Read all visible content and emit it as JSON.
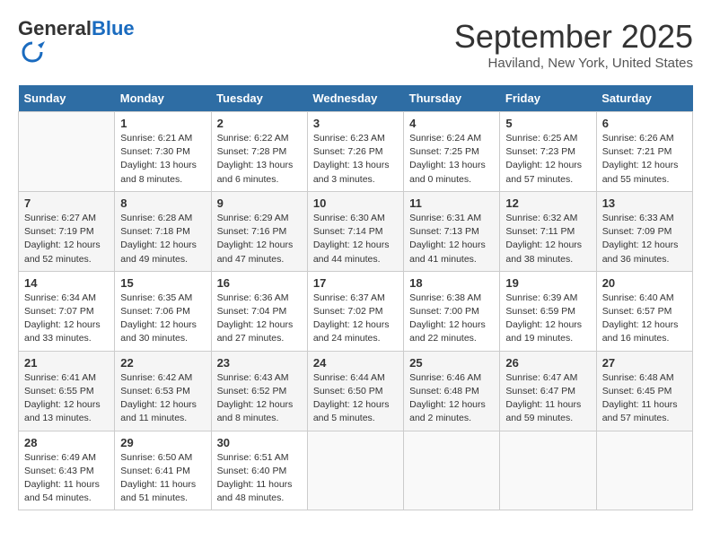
{
  "logo": {
    "general": "General",
    "blue": "Blue"
  },
  "title": "September 2025",
  "location": "Haviland, New York, United States",
  "days_of_week": [
    "Sunday",
    "Monday",
    "Tuesday",
    "Wednesday",
    "Thursday",
    "Friday",
    "Saturday"
  ],
  "weeks": [
    [
      {
        "day": "",
        "info": ""
      },
      {
        "day": "1",
        "info": "Sunrise: 6:21 AM\nSunset: 7:30 PM\nDaylight: 13 hours\nand 8 minutes."
      },
      {
        "day": "2",
        "info": "Sunrise: 6:22 AM\nSunset: 7:28 PM\nDaylight: 13 hours\nand 6 minutes."
      },
      {
        "day": "3",
        "info": "Sunrise: 6:23 AM\nSunset: 7:26 PM\nDaylight: 13 hours\nand 3 minutes."
      },
      {
        "day": "4",
        "info": "Sunrise: 6:24 AM\nSunset: 7:25 PM\nDaylight: 13 hours\nand 0 minutes."
      },
      {
        "day": "5",
        "info": "Sunrise: 6:25 AM\nSunset: 7:23 PM\nDaylight: 12 hours\nand 57 minutes."
      },
      {
        "day": "6",
        "info": "Sunrise: 6:26 AM\nSunset: 7:21 PM\nDaylight: 12 hours\nand 55 minutes."
      }
    ],
    [
      {
        "day": "7",
        "info": "Sunrise: 6:27 AM\nSunset: 7:19 PM\nDaylight: 12 hours\nand 52 minutes."
      },
      {
        "day": "8",
        "info": "Sunrise: 6:28 AM\nSunset: 7:18 PM\nDaylight: 12 hours\nand 49 minutes."
      },
      {
        "day": "9",
        "info": "Sunrise: 6:29 AM\nSunset: 7:16 PM\nDaylight: 12 hours\nand 47 minutes."
      },
      {
        "day": "10",
        "info": "Sunrise: 6:30 AM\nSunset: 7:14 PM\nDaylight: 12 hours\nand 44 minutes."
      },
      {
        "day": "11",
        "info": "Sunrise: 6:31 AM\nSunset: 7:13 PM\nDaylight: 12 hours\nand 41 minutes."
      },
      {
        "day": "12",
        "info": "Sunrise: 6:32 AM\nSunset: 7:11 PM\nDaylight: 12 hours\nand 38 minutes."
      },
      {
        "day": "13",
        "info": "Sunrise: 6:33 AM\nSunset: 7:09 PM\nDaylight: 12 hours\nand 36 minutes."
      }
    ],
    [
      {
        "day": "14",
        "info": "Sunrise: 6:34 AM\nSunset: 7:07 PM\nDaylight: 12 hours\nand 33 minutes."
      },
      {
        "day": "15",
        "info": "Sunrise: 6:35 AM\nSunset: 7:06 PM\nDaylight: 12 hours\nand 30 minutes."
      },
      {
        "day": "16",
        "info": "Sunrise: 6:36 AM\nSunset: 7:04 PM\nDaylight: 12 hours\nand 27 minutes."
      },
      {
        "day": "17",
        "info": "Sunrise: 6:37 AM\nSunset: 7:02 PM\nDaylight: 12 hours\nand 24 minutes."
      },
      {
        "day": "18",
        "info": "Sunrise: 6:38 AM\nSunset: 7:00 PM\nDaylight: 12 hours\nand 22 minutes."
      },
      {
        "day": "19",
        "info": "Sunrise: 6:39 AM\nSunset: 6:59 PM\nDaylight: 12 hours\nand 19 minutes."
      },
      {
        "day": "20",
        "info": "Sunrise: 6:40 AM\nSunset: 6:57 PM\nDaylight: 12 hours\nand 16 minutes."
      }
    ],
    [
      {
        "day": "21",
        "info": "Sunrise: 6:41 AM\nSunset: 6:55 PM\nDaylight: 12 hours\nand 13 minutes."
      },
      {
        "day": "22",
        "info": "Sunrise: 6:42 AM\nSunset: 6:53 PM\nDaylight: 12 hours\nand 11 minutes."
      },
      {
        "day": "23",
        "info": "Sunrise: 6:43 AM\nSunset: 6:52 PM\nDaylight: 12 hours\nand 8 minutes."
      },
      {
        "day": "24",
        "info": "Sunrise: 6:44 AM\nSunset: 6:50 PM\nDaylight: 12 hours\nand 5 minutes."
      },
      {
        "day": "25",
        "info": "Sunrise: 6:46 AM\nSunset: 6:48 PM\nDaylight: 12 hours\nand 2 minutes."
      },
      {
        "day": "26",
        "info": "Sunrise: 6:47 AM\nSunset: 6:47 PM\nDaylight: 11 hours\nand 59 minutes."
      },
      {
        "day": "27",
        "info": "Sunrise: 6:48 AM\nSunset: 6:45 PM\nDaylight: 11 hours\nand 57 minutes."
      }
    ],
    [
      {
        "day": "28",
        "info": "Sunrise: 6:49 AM\nSunset: 6:43 PM\nDaylight: 11 hours\nand 54 minutes."
      },
      {
        "day": "29",
        "info": "Sunrise: 6:50 AM\nSunset: 6:41 PM\nDaylight: 11 hours\nand 51 minutes."
      },
      {
        "day": "30",
        "info": "Sunrise: 6:51 AM\nSunset: 6:40 PM\nDaylight: 11 hours\nand 48 minutes."
      },
      {
        "day": "",
        "info": ""
      },
      {
        "day": "",
        "info": ""
      },
      {
        "day": "",
        "info": ""
      },
      {
        "day": "",
        "info": ""
      }
    ]
  ]
}
